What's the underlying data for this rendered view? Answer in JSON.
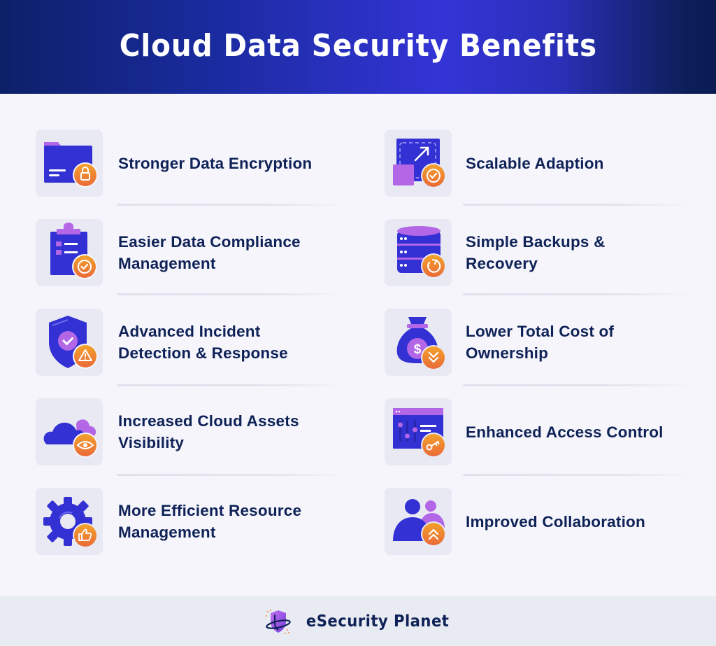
{
  "header": {
    "title": "Cloud Data Security Benefits"
  },
  "colors": {
    "header_gradient": [
      "#0c2068",
      "#3434d6",
      "#0a1c52"
    ],
    "text": "#0f2257",
    "icon_primary": "#3330d4",
    "icon_secondary": "#b366e6",
    "badge_orange": "#ec7a32",
    "tile_bg": "#e8e9f3",
    "page_bg": "#f5f5fb"
  },
  "benefits": {
    "left": [
      {
        "label": "Stronger Data Encryption",
        "icon": "folder-lock-icon"
      },
      {
        "label": "Easier Data Compliance Management",
        "icon": "clipboard-check-icon"
      },
      {
        "label": "Advanced Incident Detection & Response",
        "icon": "shield-warning-icon"
      },
      {
        "label": "Increased Cloud Assets Visibility",
        "icon": "cloud-eye-icon"
      },
      {
        "label": "More Efficient Resource Management",
        "icon": "gear-thumbs-up-icon"
      }
    ],
    "right": [
      {
        "label": "Scalable Adaption",
        "icon": "resize-check-icon"
      },
      {
        "label": "Simple Backups & Recovery",
        "icon": "database-refresh-icon"
      },
      {
        "label": "Lower Total Cost of Ownership",
        "icon": "money-bag-down-icon"
      },
      {
        "label": "Enhanced Access Control",
        "icon": "window-key-icon"
      },
      {
        "label": "Improved Collaboration",
        "icon": "users-up-icon"
      }
    ]
  },
  "footer": {
    "brand": "eSecurity Planet"
  }
}
